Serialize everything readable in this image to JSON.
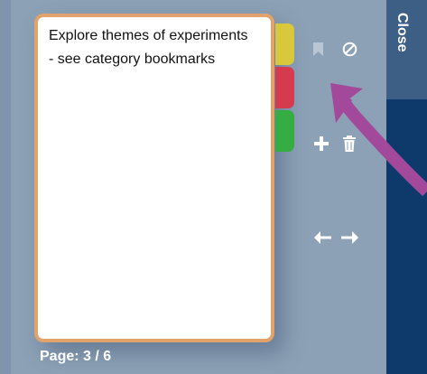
{
  "note": {
    "text": "Explore themes of experiments\n- see category bookmarks"
  },
  "tabs": [
    {
      "color": "#d9c83c"
    },
    {
      "color": "#d53a4e"
    },
    {
      "color": "#35ad43"
    }
  ],
  "toolbar": {
    "icons": [
      "bookmark-icon",
      "block-icon",
      "add-icon",
      "trash-icon",
      "arrow-left-icon",
      "arrow-right-icon"
    ]
  },
  "pagination": {
    "label": "Page: 3 / 6"
  },
  "side_panel": {
    "close_label": "Close"
  },
  "colors": {
    "background": "#8ca1b6",
    "card_border": "#e2a26c",
    "side_panel": "#0d3a6b",
    "close_button": "#3d5f86",
    "annotation_arrow": "#a3499c"
  }
}
